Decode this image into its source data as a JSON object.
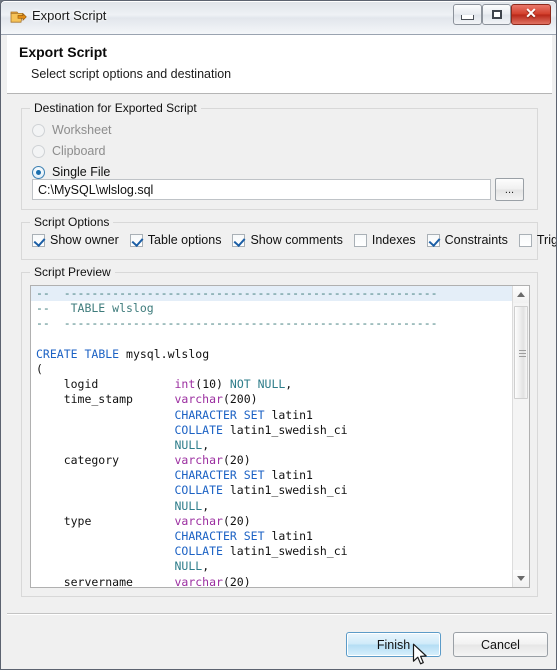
{
  "window": {
    "title": "Export Script",
    "icon": "export-script-icon",
    "controls": {
      "minimize": "minimize-icon",
      "maximize": "restore-icon",
      "close": "close-icon",
      "close_glyph": "✕"
    }
  },
  "header": {
    "title": "Export Script",
    "subtitle": "Select script options and destination"
  },
  "destination": {
    "group_label": "Destination for Exported Script",
    "options": [
      {
        "label": "Worksheet",
        "selected": false,
        "disabled": true
      },
      {
        "label": "Clipboard",
        "selected": false,
        "disabled": true
      },
      {
        "label": "Single File",
        "selected": true,
        "disabled": false
      }
    ],
    "path_value": "C:\\MySQL\\wlslog.sql",
    "browse_label": "..."
  },
  "script_options": {
    "group_label": "Script Options",
    "items": [
      {
        "label": "Show owner",
        "checked": true
      },
      {
        "label": "Table options",
        "checked": true
      },
      {
        "label": "Show comments",
        "checked": true
      },
      {
        "label": "Indexes",
        "checked": false
      },
      {
        "label": "Constraints",
        "checked": true
      },
      {
        "label": "Triggers",
        "checked": false
      }
    ]
  },
  "script_preview": {
    "group_label": "Script Preview",
    "lines": [
      "--  ------------------------------------------------------",
      "--   TABLE wlslog",
      "--  ------------------------------------------------------",
      "",
      "CREATE TABLE mysql.wlslog",
      "(",
      "    logid           int(10) NOT NULL,",
      "    time_stamp      varchar(200)",
      "                    CHARACTER SET latin1",
      "                    COLLATE latin1_swedish_ci",
      "                    NULL,",
      "    category        varchar(20)",
      "                    CHARACTER SET latin1",
      "                    COLLATE latin1_swedish_ci",
      "                    NULL,",
      "    type            varchar(20)",
      "                    CHARACTER SET latin1",
      "                    COLLATE latin1_swedish_ci",
      "                    NULL,",
      "    servername      varchar(20)"
    ],
    "highlighted_line_index": 0,
    "scrollbar": {
      "up_arrow": "scroll-up-icon",
      "down_arrow": "scroll-down-icon",
      "thumb_top_pct": 1,
      "thumb_height_pct": 35
    }
  },
  "footer": {
    "finish_label": "Finish",
    "cancel_label": "Cancel"
  },
  "colors": {
    "comment": "#3f7c7c",
    "keyword": "#1c62c4",
    "type": "#9b2ea0",
    "null_kw": "#2e7d8a",
    "accent_selected": "#1c6fae",
    "close_button": "#c8392a",
    "highlight_line": "#e4eef8"
  }
}
